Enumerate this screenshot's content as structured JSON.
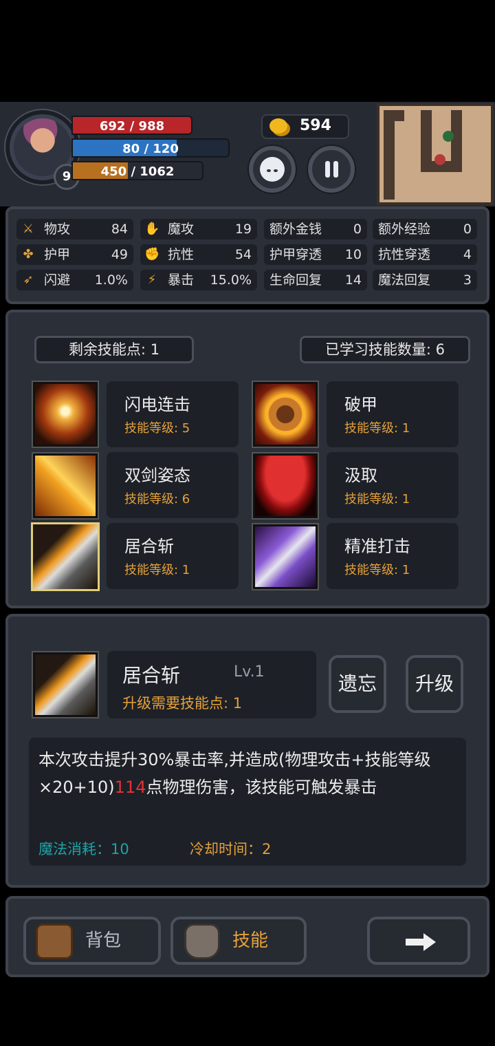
{
  "hud": {
    "level": "9",
    "hp": {
      "text": "692 / 988",
      "current": 692,
      "max": 988
    },
    "mp": {
      "text": "80 / 120",
      "current": 80,
      "max": 120
    },
    "xp": {
      "current_text": "450",
      "max_text": " / 1062",
      "current": 450,
      "max": 1062
    },
    "gold": "594"
  },
  "stats": [
    {
      "label": "物攻",
      "value": "84",
      "icon": "sword-icon"
    },
    {
      "label": "魔攻",
      "value": "19",
      "icon": "magic-hand-icon"
    },
    {
      "label": "额外金钱",
      "value": "0",
      "icon": ""
    },
    {
      "label": "额外经验",
      "value": "0",
      "icon": ""
    },
    {
      "label": "护甲",
      "value": "49",
      "icon": "paw-icon"
    },
    {
      "label": "抗性",
      "value": "54",
      "icon": "muscle-icon"
    },
    {
      "label": "护甲穿透",
      "value": "10",
      "icon": ""
    },
    {
      "label": "抗性穿透",
      "value": "4",
      "icon": ""
    },
    {
      "label": "闪避",
      "value": "1.0%",
      "icon": "running-icon"
    },
    {
      "label": "暴击",
      "value": "15.0%",
      "icon": "lightning-icon"
    },
    {
      "label": "生命回复",
      "value": "14",
      "icon": ""
    },
    {
      "label": "魔法回复",
      "value": "3",
      "icon": ""
    }
  ],
  "skills_panel": {
    "remaining_points": "剩余技能点: 1",
    "learned_count": "已学习技能数量: 6",
    "skills": [
      {
        "name": "闪电连击",
        "level": "技能等级: 5",
        "icon": "lightning-burst-icon"
      },
      {
        "name": "破甲",
        "level": "技能等级: 1",
        "icon": "shield-break-icon"
      },
      {
        "name": "双剑姿态",
        "level": "技能等级: 6",
        "icon": "dual-swords-icon"
      },
      {
        "name": "汲取",
        "level": "技能等级: 1",
        "icon": "blood-drain-icon"
      },
      {
        "name": "居合斩",
        "level": "技能等级: 1",
        "icon": "flaming-blade-icon",
        "selected": true
      },
      {
        "name": "精准打击",
        "level": "技能等级: 1",
        "icon": "precise-sword-icon"
      }
    ]
  },
  "detail": {
    "name": "居合斩",
    "level": "Lv.1",
    "upgrade_req": "升级需要技能点: 1",
    "forget_btn": "遗忘",
    "upgrade_btn": "升级",
    "desc_part1": "本次攻击提升30%暴击率,并造成(物理攻击+技能等级×20+10)",
    "desc_damage": "114",
    "desc_part2": "点物理伤害，该技能可触发暴击",
    "mana_cost_label": "魔法消耗：",
    "mana_cost": "10",
    "cooldown_label": "冷却时间：",
    "cooldown": "2"
  },
  "bottom": {
    "bag_label": "背包",
    "skill_label": "技能",
    "next_icon": "arrow-right-icon"
  },
  "colors": {
    "hp": "#b8262a",
    "mp": "#2c74c2",
    "xp": "#b7701f",
    "accent": "#e6a23a",
    "teal": "#1fa3a6"
  }
}
